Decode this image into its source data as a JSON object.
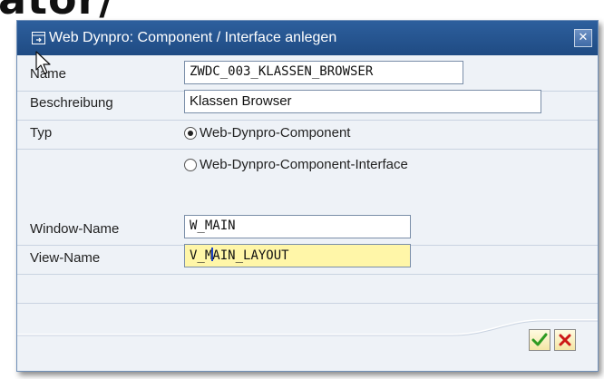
{
  "background": {
    "heading_text": "ator/"
  },
  "dialog": {
    "title": "Web Dynpro: Component / Interface anlegen",
    "icons": {
      "title": "dialog-window-icon",
      "close": "close-icon",
      "cursor": "mouse-pointer-icon",
      "ok": "checkmark-icon",
      "cancel": "cancel-x-icon"
    }
  },
  "form": {
    "name": {
      "label": "Name",
      "value": "ZWDC_003_KLASSEN_BROWSER"
    },
    "description": {
      "label": "Beschreibung",
      "value": "Klassen Browser"
    },
    "type": {
      "label": "Typ",
      "options": [
        {
          "label": "Web-Dynpro-Component",
          "selected": true
        },
        {
          "label": "Web-Dynpro-Component-Interface",
          "selected": false
        }
      ]
    },
    "window_name": {
      "label": "Window-Name",
      "value": "W_MAIN"
    },
    "view_name": {
      "label": "View-Name",
      "value_before_caret": "V_M",
      "value_after_caret": "AIN_LAYOUT"
    }
  },
  "colors": {
    "titlebar": "#1f4b83",
    "active_field": "#fff6a8",
    "ok": "#2e9a22",
    "cancel": "#cc1616"
  }
}
